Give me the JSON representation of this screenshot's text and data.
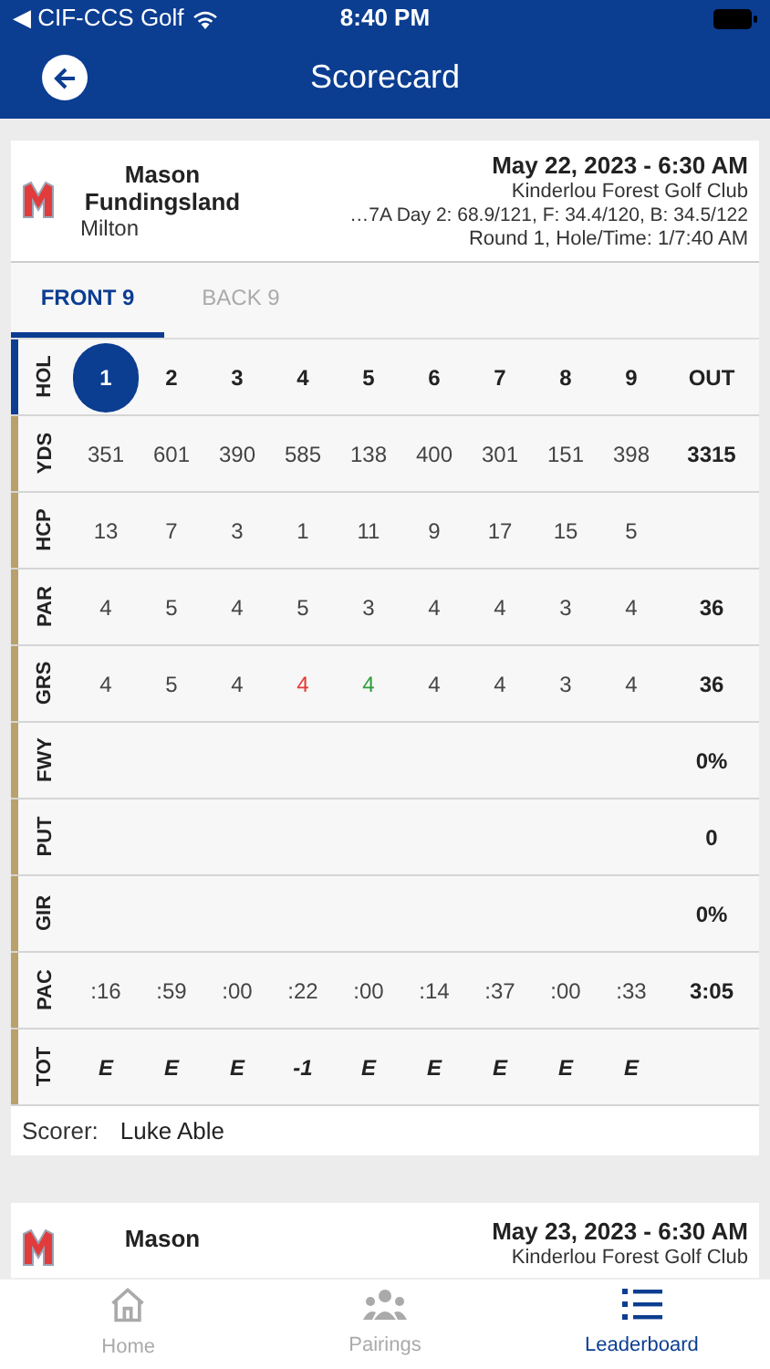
{
  "status_bar": {
    "back_app": "◀ CIF-CCS Golf",
    "time": "8:40 PM"
  },
  "header": {
    "title": "Scorecard"
  },
  "cards": [
    {
      "player": "Mason Fundingsland",
      "school": "Milton",
      "date": "May 22, 2023 - 6:30 AM",
      "course": "Kinderlou Forest Golf Club",
      "ratings": "…7A Day 2: 68.9/121, F: 34.4/120, B: 34.5/122",
      "round": "Round 1, Hole/Time: 1/7:40 AM",
      "tabs": [
        {
          "label": "FRONT 9",
          "selected": true
        },
        {
          "label": "BACK 9",
          "selected": false
        }
      ],
      "rows": [
        {
          "label": "HOL",
          "kind": "hole",
          "cells": [
            {
              "text": "1",
              "selected": true
            },
            {
              "text": "2",
              "selected": false
            },
            {
              "text": "3",
              "selected": false
            },
            {
              "text": "4",
              "selected": false
            },
            {
              "text": "5",
              "selected": false
            },
            {
              "text": "6",
              "selected": false
            },
            {
              "text": "7",
              "selected": false
            },
            {
              "text": "8",
              "selected": false
            },
            {
              "text": "9",
              "selected": false
            }
          ],
          "total": "OUT"
        },
        {
          "label": "YDS",
          "kind": "stat",
          "cells": [
            "351",
            "601",
            "390",
            "585",
            "138",
            "400",
            "301",
            "151",
            "398"
          ],
          "total": "3315"
        },
        {
          "label": "HCP",
          "kind": "stat",
          "cells": [
            "13",
            "7",
            "3",
            "1",
            "11",
            "9",
            "17",
            "15",
            "5"
          ]
        },
        {
          "label": "PAR",
          "kind": "stat",
          "cells": [
            "4",
            "5",
            "4",
            "5",
            "3",
            "4",
            "4",
            "3",
            "4"
          ],
          "total": "36"
        },
        {
          "label": "GRS",
          "kind": "score",
          "cells": [
            {
              "text": "4",
              "color": "#444444"
            },
            {
              "text": "5",
              "color": "#444444"
            },
            {
              "text": "4",
              "color": "#444444"
            },
            {
              "text": "4",
              "color": "#e53935"
            },
            {
              "text": "4",
              "color": "#2e9e3a"
            },
            {
              "text": "4",
              "color": "#444444"
            },
            {
              "text": "4",
              "color": "#444444"
            },
            {
              "text": "3",
              "color": "#444444"
            },
            {
              "text": "4",
              "color": "#444444"
            }
          ],
          "total": "36"
        },
        {
          "label": "FWY",
          "kind": "stat",
          "cells": [],
          "total": "0%"
        },
        {
          "label": "PUT",
          "kind": "stat",
          "cells": [],
          "total": "0"
        },
        {
          "label": "GIR",
          "kind": "stat",
          "cells": [],
          "total": "0%"
        },
        {
          "label": "PAC",
          "kind": "stat",
          "cells": [
            ":16",
            ":59",
            ":00",
            ":22",
            ":00",
            ":14",
            ":37",
            ":00",
            ":33"
          ],
          "total": "3:05"
        },
        {
          "label": "TOT",
          "kind": "total",
          "cells": [
            "E",
            "E",
            "E",
            "-1",
            "E",
            "E",
            "E",
            "E",
            "E"
          ]
        }
      ],
      "scorer_label": "Scorer:",
      "scorer": "Luke Able"
    },
    {
      "player": "Mason",
      "date": "May 23, 2023 - 6:30 AM",
      "course": "Kinderlou Forest Golf Club"
    }
  ],
  "tab_bar": [
    {
      "label": "Home",
      "kind": "home",
      "selected": false
    },
    {
      "label": "Pairings",
      "kind": "group",
      "selected": false
    },
    {
      "label": "Leaderboard",
      "kind": "list",
      "selected": true
    }
  ]
}
